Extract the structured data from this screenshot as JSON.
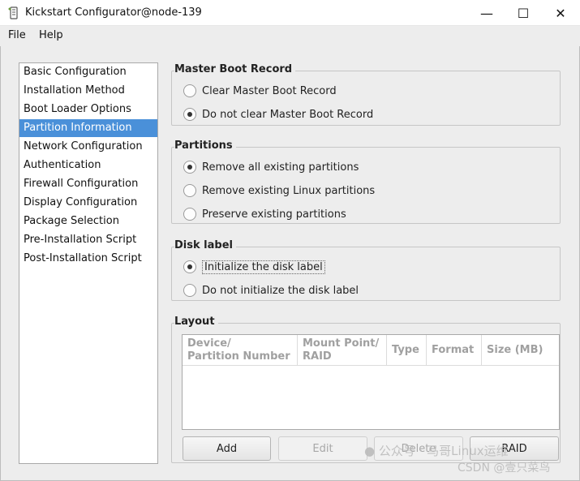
{
  "window": {
    "title": "Kickstart Configurator@node-139",
    "minimize_glyph": "—",
    "maximize_glyph": "☐",
    "close_glyph": "✕"
  },
  "menubar": {
    "items": [
      "File",
      "Help"
    ]
  },
  "sidebar": {
    "items": [
      "Basic Configuration",
      "Installation Method",
      "Boot Loader Options",
      "Partition Information",
      "Network Configuration",
      "Authentication",
      "Firewall Configuration",
      "Display Configuration",
      "Package Selection",
      "Pre-Installation Script",
      "Post-Installation Script"
    ],
    "selected": "Partition Information"
  },
  "mbr": {
    "title": "Master Boot Record",
    "options": [
      "Clear Master Boot Record",
      "Do not clear Master Boot Record"
    ],
    "selected": "Do not clear Master Boot Record"
  },
  "partitions": {
    "title": "Partitions",
    "options": [
      "Remove all existing partitions",
      "Remove existing Linux partitions",
      "Preserve existing partitions"
    ],
    "selected": "Remove all existing partitions"
  },
  "disk_label": {
    "title": "Disk label",
    "options": [
      "Initialize the disk label",
      "Do not initialize the disk label"
    ],
    "selected": "Initialize the disk label"
  },
  "layout": {
    "title": "Layout",
    "columns": [
      {
        "line1": "Device/",
        "line2": "Partition Number"
      },
      {
        "line1": "Mount Point/",
        "line2": "RAID"
      },
      {
        "line1": "Type",
        "line2": ""
      },
      {
        "line1": "Format",
        "line2": ""
      },
      {
        "line1": "Size (MB)",
        "line2": ""
      }
    ],
    "rows": [],
    "buttons": {
      "add": "Add",
      "edit": "Edit",
      "delete": "Delete",
      "raid": "RAID"
    }
  },
  "watermark": {
    "line1": "公众号 · 马哥Linux运维",
    "line2": "CSDN @壹只菜鸟"
  },
  "colors": {
    "selection": "#4a90d9",
    "window_bg": "#ededed"
  }
}
